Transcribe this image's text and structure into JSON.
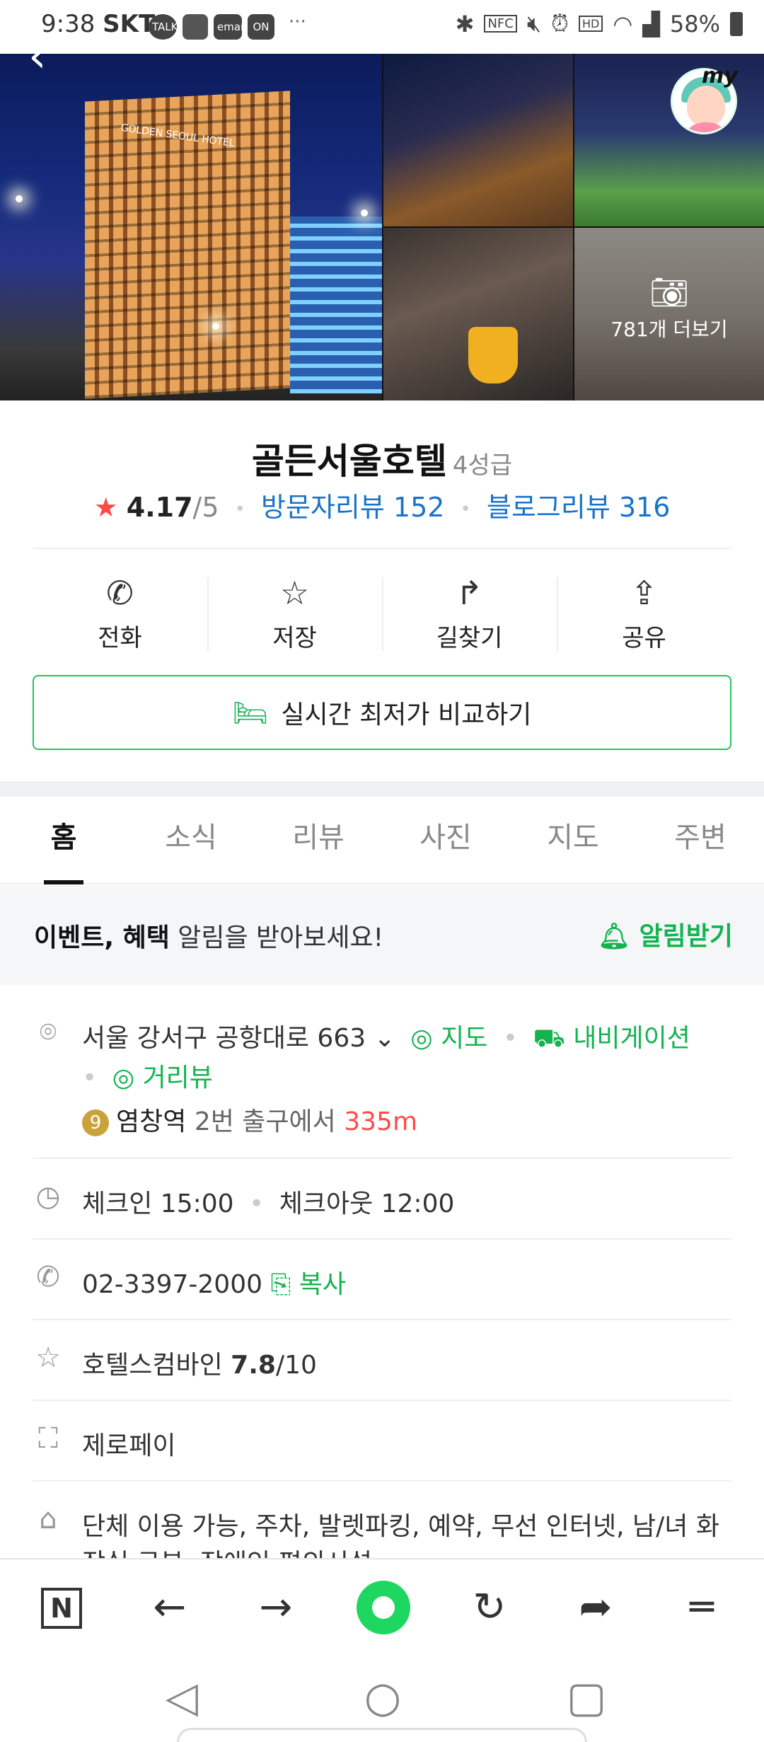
{
  "status_bar": {
    "time": "9:38",
    "carrier": "SKT",
    "badges": [
      "TALK",
      "",
      "emart",
      "ON"
    ],
    "more": "···",
    "battery": "58%"
  },
  "photos": {
    "more_label": "781개 더보기",
    "my_label": "my",
    "hotel_sign": "GOLDEN SEOUL HOTEL"
  },
  "place": {
    "name": "골든서울호텔",
    "grade": "4성급",
    "rating": "4.17",
    "rating_max": "/5",
    "visitor_review": "방문자리뷰 152",
    "blog_review": "블로그리뷰 316"
  },
  "actions": [
    {
      "label": "전화",
      "icon": "✆"
    },
    {
      "label": "저장",
      "icon": "☆"
    },
    {
      "label": "길찾기",
      "icon": "↱"
    },
    {
      "label": "공유",
      "icon": "⇪"
    }
  ],
  "compare_button": "실시간 최저가 비교하기",
  "tabs": [
    "홈",
    "소식",
    "리뷰",
    "사진",
    "지도",
    "주변"
  ],
  "active_tab": "홈",
  "alert": {
    "bold": "이벤트, 혜택",
    "rest": " 알림을 받아보세요!",
    "button": "알림받기"
  },
  "info": {
    "address": "서울 강서구 공항대로 663",
    "map_link": "지도",
    "navi_link": "내비게이션",
    "street_view": "거리뷰",
    "subway_line": "9",
    "station": "염창역",
    "exit": "2번 출구에서",
    "distance": "335m",
    "checkin": "체크인 15:00",
    "checkout": "체크아웃 12:00",
    "phone": "02-3397-2000",
    "copy": "복사",
    "hotels_combined_prefix": "호텔스컴바인 ",
    "hotels_combined_score": "7.8",
    "hotels_combined_max": "/10",
    "zeropay": "제로페이",
    "amenities_line1": "단체 이용 가능, 주차, 발렛파킹, 예약, 무선 인터넷, 남/녀 화",
    "amenities_line2": "장실 구분, 장애인 편의시설"
  },
  "browser_bar": {
    "logo": "N"
  }
}
